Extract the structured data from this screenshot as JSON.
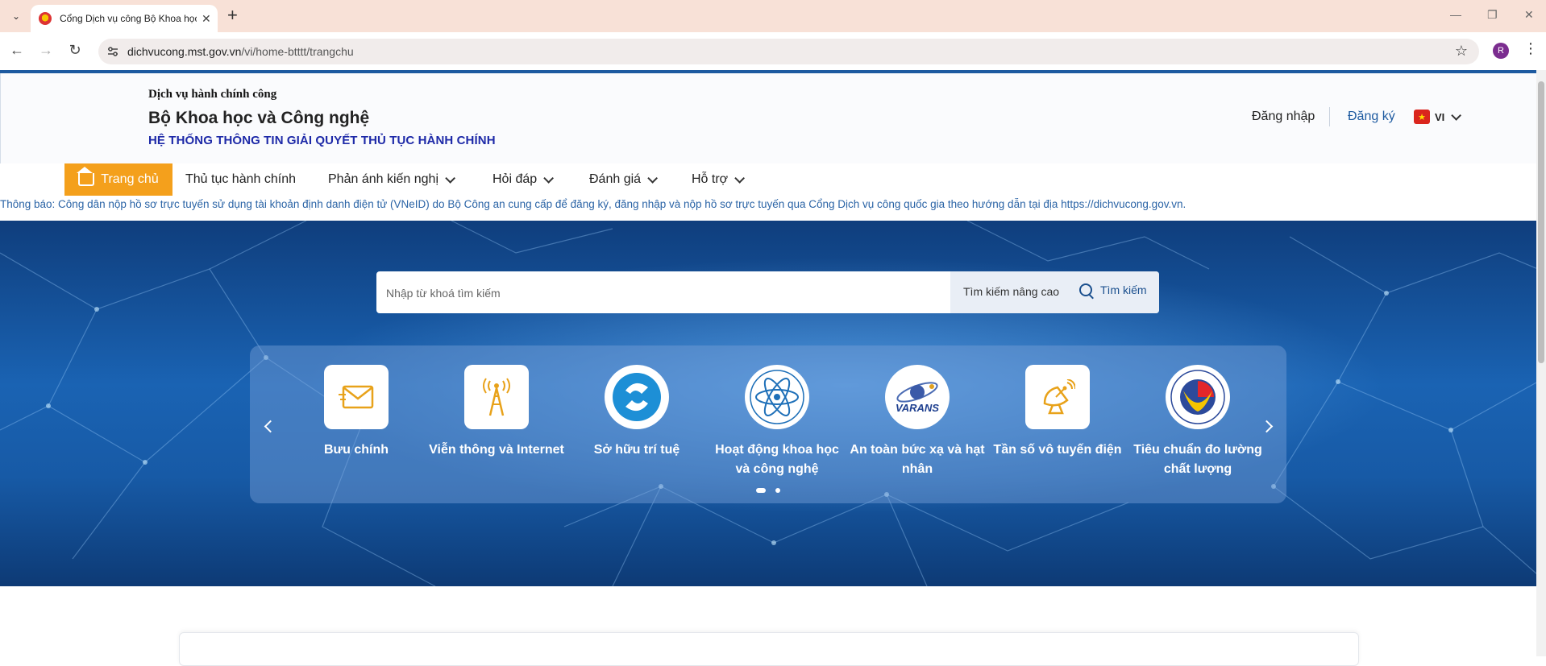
{
  "browser": {
    "tab_title": "Cổng Dịch vụ công Bộ Khoa học và Công nghệ",
    "url_domain": "dichvucong.mst.gov.vn",
    "url_path": "/vi/home-btttt/trangchu",
    "profile_initial": "R"
  },
  "header": {
    "small_title": "Dịch vụ hành chính công",
    "title": "Bộ Khoa học và Công nghệ",
    "subtitle": "HỆ THỐNG THÔNG TIN GIẢI QUYẾT THỦ TỤC HÀNH CHÍNH",
    "login": "Đăng nhập",
    "register": "Đăng ký",
    "language": "VI"
  },
  "nav": {
    "home": "Trang chủ",
    "procedures": "Thủ tục hành chính",
    "feedback": "Phản ánh kiến nghị",
    "qa": "Hỏi đáp",
    "rating": "Đánh giá",
    "support": "Hỗ trợ"
  },
  "notice": "Thông báo: Công dân nộp hồ sơ trực tuyến sử dụng tài khoản định danh điện tử (VNeID) do Bộ Công an cung cấp để đăng ký, đăng nhập và nộp hồ sơ trực tuyến qua Cổng Dịch vụ công quốc gia theo hướng dẫn tại địa https://dichvucong.gov.vn.",
  "search": {
    "placeholder": "Nhập từ khoá tìm kiếm",
    "advanced": "Tìm kiếm nâng cao",
    "button": "Tìm kiếm"
  },
  "categories": [
    {
      "label": "Bưu chính",
      "icon": "envelope-icon"
    },
    {
      "label": "Viễn thông và Internet",
      "icon": "antenna-tower-icon"
    },
    {
      "label": "Sở hữu trí tuệ",
      "icon": "ip-logo-icon"
    },
    {
      "label": "Hoạt động khoa học và công nghệ",
      "icon": "atom-icon"
    },
    {
      "label": "An toàn bức xạ và hạt nhân",
      "icon": "varans-logo-icon",
      "logo_text": "VARANS"
    },
    {
      "label": "Tần số vô tuyến điện",
      "icon": "satellite-dish-icon"
    },
    {
      "label": "Tiêu chuẩn đo lường chất lượng",
      "icon": "standards-seal-icon"
    }
  ],
  "carousel": {
    "pages": 2,
    "active_page": 1
  },
  "colors": {
    "accent_orange": "#f4a01c",
    "brand_blue": "#1d5aa0",
    "subtitle_blue": "#1e2aa8"
  }
}
